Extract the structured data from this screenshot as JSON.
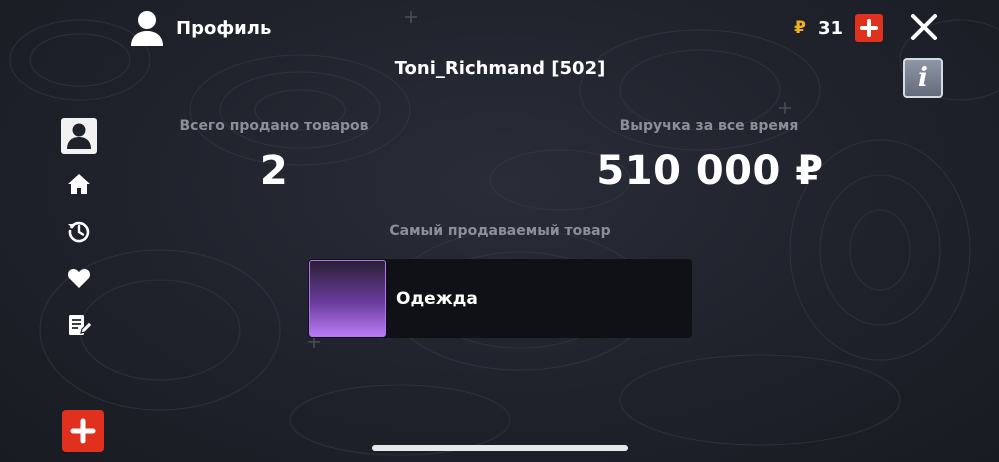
{
  "header": {
    "title": "Профиль",
    "balance": "31",
    "balance_icon": "ruble-coin-icon"
  },
  "user": {
    "name": "Toni_Richmand [502]"
  },
  "stats": {
    "sold_label": "Всего продано товаров",
    "sold_value": "2",
    "revenue_label": "Выручка за все время",
    "revenue_value": "510 000 ₽"
  },
  "best_item": {
    "label": "Самый продаваемый товар",
    "name": "Одежда"
  },
  "sidebar": {
    "items": [
      {
        "icon": "profile-icon",
        "active": true
      },
      {
        "icon": "home-icon",
        "active": false
      },
      {
        "icon": "history-icon",
        "active": false
      },
      {
        "icon": "heart-icon",
        "active": false
      },
      {
        "icon": "notes-edit-icon",
        "active": false
      }
    ]
  },
  "colors": {
    "accent_red": "#e0301e",
    "coin_gold": "#f2b01e",
    "item_purple": "#b275f2",
    "label_gray": "#8b8f9a"
  }
}
